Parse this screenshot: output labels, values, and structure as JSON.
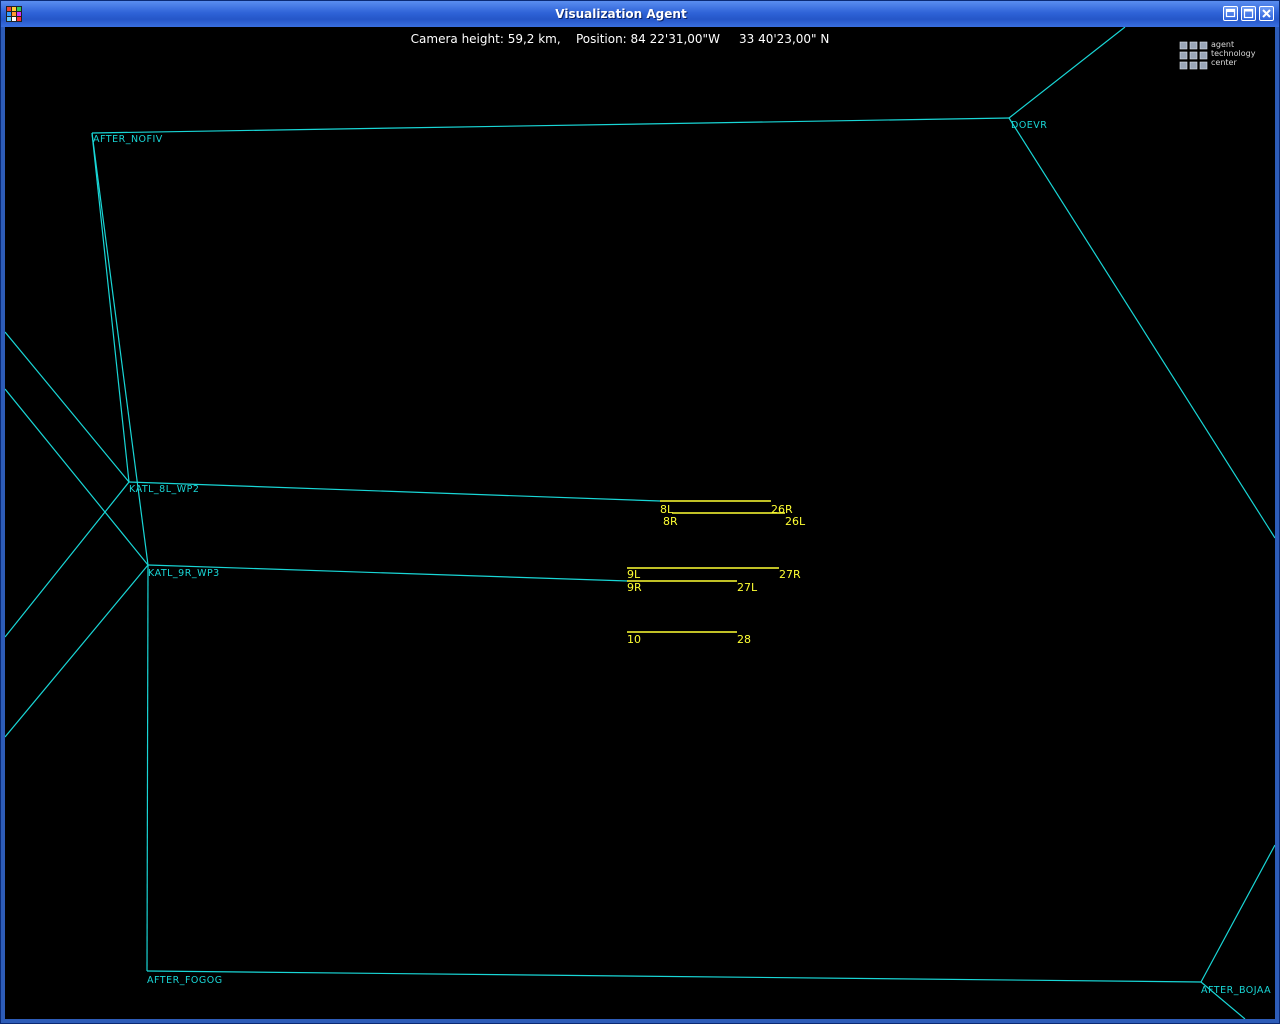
{
  "window": {
    "title": "Visualization Agent",
    "buttons": [
      {
        "name": "minimize-button",
        "icon": "minimize-icon"
      },
      {
        "name": "maximize-button",
        "icon": "maximize-icon"
      },
      {
        "name": "close-button",
        "icon": "close-icon"
      }
    ]
  },
  "info_bar": {
    "camera_label": "Camera height:",
    "camera_value": "59,2 km,",
    "position_label": "Position:",
    "longitude": "84 22'31,00\"W",
    "latitude": "33 40'23,00\" N"
  },
  "logo": {
    "line1": "agent",
    "line2": "technology",
    "line3": "center"
  },
  "waypoints": {
    "after_nofiv": "AFTER_NOFIV",
    "doevr": "DOEVR",
    "katl_8l_wp2": "KATL_8L_WP2",
    "katl_9r_wp3": "KATL_9R_WP3",
    "after_fogog": "AFTER_FOGOG",
    "after_bojaa": "AFTER_BOJAA"
  },
  "runways": {
    "r8l": "8L",
    "r26r": "26R",
    "r8r": "8R",
    "r26l": "26L",
    "r9l": "9L",
    "r27r": "27R",
    "r9r": "9R",
    "r27l": "27L",
    "r10": "10",
    "r28": "28"
  },
  "colors": {
    "route": "#19d6d6",
    "runway": "#ffff33",
    "background": "#000000"
  }
}
